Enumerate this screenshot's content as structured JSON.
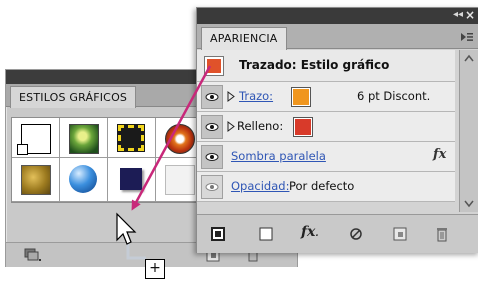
{
  "styles_panel": {
    "tab_label": "ESTILOS GRÁFICOS"
  },
  "appearance_panel": {
    "tab_label": "APARIENCIA",
    "header_label": "Trazado: Estilo gráfico",
    "rows": {
      "stroke": {
        "label": "Trazo:",
        "value": "6 pt Discont.",
        "swatch_color": "#f0961e"
      },
      "fill": {
        "label": "Relleno:",
        "swatch_color": "#d83a2a"
      },
      "shadow": {
        "label": "Sombra paralela",
        "fx": "fx"
      },
      "opacity": {
        "label": "Opacidad:",
        "value": "Por defecto"
      }
    }
  },
  "drag_cursor": {
    "plus": "+"
  },
  "colors": {
    "arrow": "#c8287a",
    "link": "#2f56b5",
    "header_thumb": "#e0522a"
  }
}
